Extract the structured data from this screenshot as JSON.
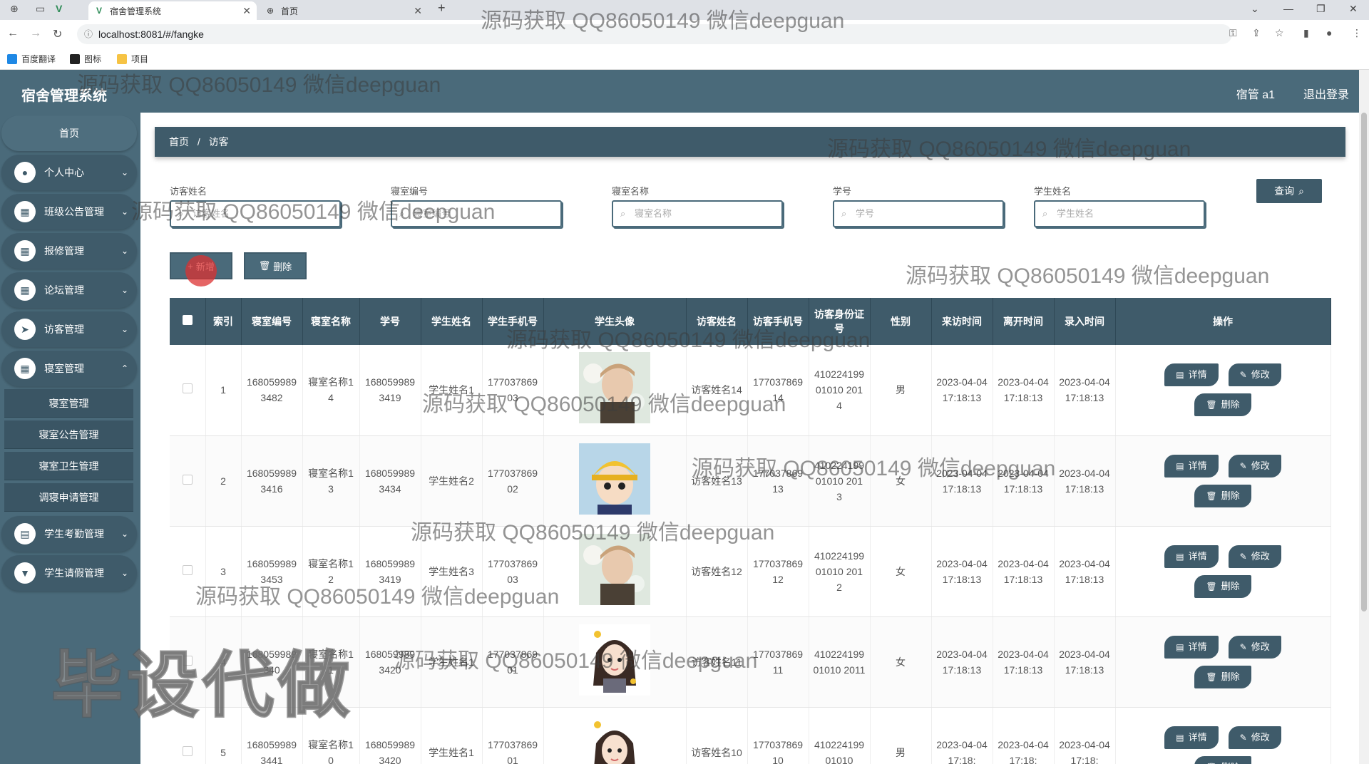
{
  "browser": {
    "tabs": [
      {
        "title": "宿舍管理系统",
        "active": true
      },
      {
        "title": "首页",
        "active": false
      }
    ],
    "url": "localhost:8081/#/fangke",
    "bookmarks": [
      "百度翻译",
      "图标",
      "项目"
    ]
  },
  "app": {
    "title": "宿舍管理系统",
    "user": "宿管 a1",
    "logout": "退出登录"
  },
  "sidebar": {
    "items": [
      {
        "label": "首页",
        "icon": "home"
      },
      {
        "label": "个人中心",
        "icon": "user-icon"
      },
      {
        "label": "班级公告管理",
        "icon": "grid-icon"
      },
      {
        "label": "报修管理",
        "icon": "grid-icon"
      },
      {
        "label": "论坛管理",
        "icon": "grid-icon"
      },
      {
        "label": "访客管理",
        "icon": "send-icon"
      },
      {
        "label": "寝室管理",
        "icon": "grid-icon"
      },
      {
        "label": "学生考勤管理",
        "icon": "clipboard-icon"
      },
      {
        "label": "学生请假管理",
        "icon": "podium-icon"
      }
    ],
    "submenu": [
      "寝室管理",
      "寝室公告管理",
      "寝室卫生管理",
      "调寝申请管理"
    ]
  },
  "breadcrumb": [
    "首页",
    "/",
    "访客"
  ],
  "filters": [
    {
      "label": "访客姓名",
      "placeholder": "访客姓名"
    },
    {
      "label": "寝室编号",
      "placeholder": "寝室编号"
    },
    {
      "label": "寝室名称",
      "placeholder": "寝室名称"
    },
    {
      "label": "学号",
      "placeholder": "学号"
    },
    {
      "label": "学生姓名",
      "placeholder": "学生姓名"
    }
  ],
  "buttons": {
    "query": "查询",
    "add": "新增",
    "delete": "删除",
    "detail": "详情",
    "edit": "修改",
    "row_delete": "删除"
  },
  "table": {
    "headers": [
      "索引",
      "寝室编号",
      "寝室名称",
      "学号",
      "学生姓名",
      "学生手机号",
      "学生头像",
      "访客姓名",
      "访客手机号",
      "访客身份证号",
      "性别",
      "来访时间",
      "离开时间",
      "录入时间",
      "操作"
    ],
    "rows": [
      {
        "idx": "1",
        "room_no": "1680599893482",
        "room_name": "寝室名称14",
        "stu_no": "1680599893419",
        "stu_name": "学生姓名1",
        "stu_phone": "17703786903",
        "visitor": "访客姓名14",
        "v_phone": "17703786914",
        "v_id": "41022419901010 2014",
        "gender": "男",
        "t1": "2023-04-04 17:18:13",
        "t2": "2023-04-04 17:18:13",
        "t3": "2023-04-04 17:18:13",
        "avatar": "photo-boy"
      },
      {
        "idx": "2",
        "room_no": "1680599893416",
        "room_name": "寝室名称13",
        "stu_no": "1680599893434",
        "stu_name": "学生姓名2",
        "stu_phone": "17703786902",
        "visitor": "访客姓名13",
        "v_phone": "17703786913",
        "v_id": "41022419901010 2013",
        "gender": "女",
        "t1": "2023-04-04 17:18:13",
        "t2": "2023-04-04 17:18:13",
        "t3": "2023-04-04 17:18:13",
        "avatar": "cartoon-boy"
      },
      {
        "idx": "3",
        "room_no": "1680599893453",
        "room_name": "寝室名称12",
        "stu_no": "1680599893419",
        "stu_name": "学生姓名3",
        "stu_phone": "17703786903",
        "visitor": "访客姓名12",
        "v_phone": "17703786912",
        "v_id": "41022419901010 2012",
        "gender": "女",
        "t1": "2023-04-04 17:18:13",
        "t2": "2023-04-04 17:18:13",
        "t3": "2023-04-04 17:18:13",
        "avatar": "photo-boy"
      },
      {
        "idx": "4",
        "room_no": "168059989340",
        "room_name": "寝室名称11",
        "stu_no": "1680599893420",
        "stu_name": "学生姓名1",
        "stu_phone": "17703786901",
        "visitor": "访客姓名11",
        "v_phone": "17703786911",
        "v_id": "41022419901010 2011",
        "gender": "女",
        "t1": "2023-04-04 17:18:13",
        "t2": "2023-04-04 17:18:13",
        "t3": "2023-04-04 17:18:13",
        "avatar": "cartoon-girl"
      },
      {
        "idx": "5",
        "room_no": "1680599893441",
        "room_name": "寝室名称10",
        "stu_no": "1680599893420",
        "stu_name": "学生姓名1",
        "stu_phone": "17703786901",
        "visitor": "访客姓名10",
        "v_phone": "17703786910",
        "v_id": "41022419901010",
        "gender": "男",
        "t1": "2023-04-04 17:18:",
        "t2": "2023-04-04 17:18:",
        "t3": "2023-04-04 17:18:",
        "avatar": "cartoon-girl"
      }
    ]
  },
  "watermarks": {
    "text": "源码获取 QQ86050149 微信deepguan",
    "big": "毕设代做"
  },
  "colors": {
    "primary": "#3f5b6a",
    "header": "#4a6a7a"
  }
}
